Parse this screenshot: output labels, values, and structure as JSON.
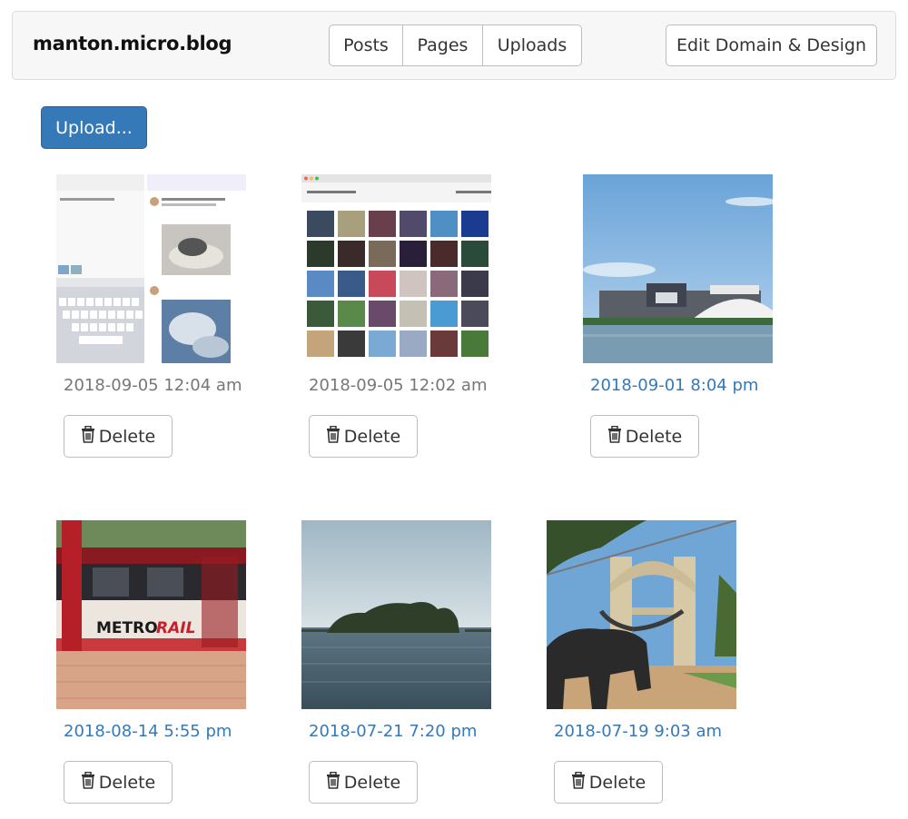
{
  "navbar": {
    "brand": "manton.micro.blog",
    "tabs": [
      {
        "label": "Posts"
      },
      {
        "label": "Pages"
      },
      {
        "label": "Uploads"
      }
    ],
    "edit_button": "Edit Domain & Design"
  },
  "upload_button": "Upload...",
  "uploads": [
    {
      "date": "2018-09-05 12:04 am",
      "delete_label": "Delete",
      "linked": false,
      "thumb": "app-screenshot-icon"
    },
    {
      "date": "2018-09-05 12:02 am",
      "delete_label": "Delete",
      "linked": false,
      "thumb": "instagram-import-screenshot-icon"
    },
    {
      "date": "2018-09-01 8:04 pm",
      "delete_label": "Delete",
      "linked": true,
      "thumb": "stadium-photo"
    },
    {
      "date": "2018-08-14 5:55 pm",
      "delete_label": "Delete",
      "linked": true,
      "thumb": "metrorail-photo"
    },
    {
      "date": "2018-07-21 7:20 pm",
      "delete_label": "Delete",
      "linked": true,
      "thumb": "lake-island-photo"
    },
    {
      "date": "2018-07-19 9:03 am",
      "delete_label": "Delete",
      "linked": true,
      "thumb": "bridge-longhorn-photo"
    }
  ],
  "colors": {
    "link": "#3579b8",
    "primary": "#3579b8",
    "muted": "#777777"
  }
}
